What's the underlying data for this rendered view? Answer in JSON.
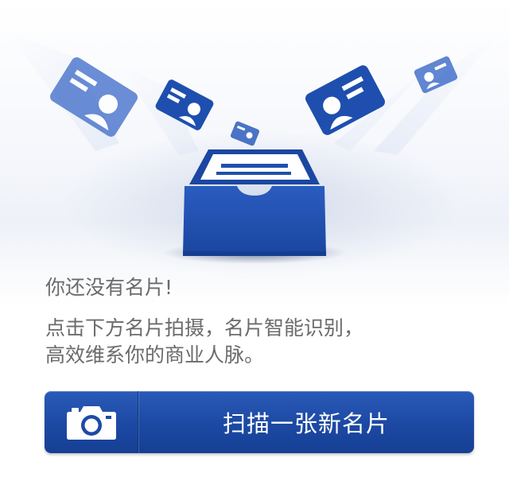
{
  "empty_state": {
    "title": "你还没有名片!",
    "description_line1": "点击下方名片拍摄，名片智能识别，",
    "description_line2": "高效维系你的商业人脉。"
  },
  "scan_button": {
    "label": "扫描一张新名片",
    "icon": "camera-icon"
  },
  "colors": {
    "brand_blue": "#1d4aa5",
    "text_gray": "#6b6b6b",
    "button_text": "#ffffff"
  }
}
